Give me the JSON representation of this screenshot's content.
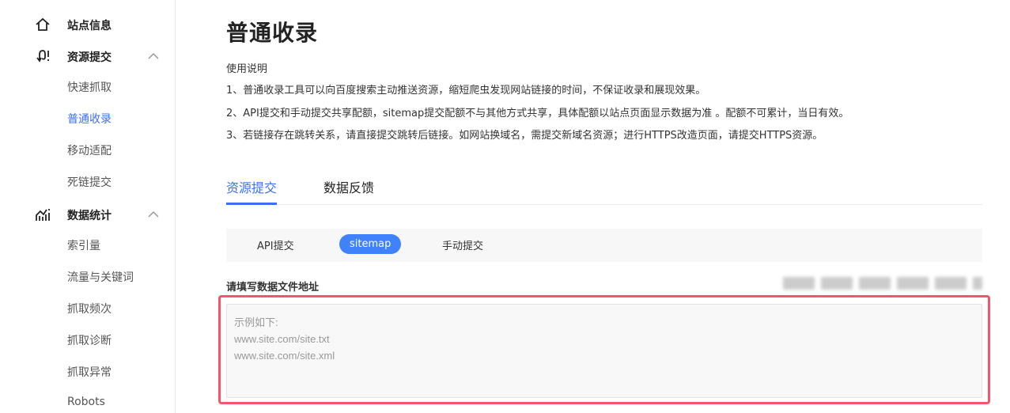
{
  "sidebar": {
    "groups": [
      {
        "label": "站点信息",
        "icon": "home-icon"
      },
      {
        "label": "资源提交",
        "icon": "submit-icon"
      },
      {
        "label": "数据统计",
        "icon": "chart-icon"
      }
    ],
    "resource_items": [
      "快速抓取",
      "普通收录",
      "移动适配",
      "死链提交"
    ],
    "stats_items": [
      "索引量",
      "流量与关键词",
      "抓取频次",
      "抓取诊断",
      "抓取异常",
      "Robots"
    ],
    "active": "普通收录"
  },
  "main": {
    "title": "普通收录",
    "instructions_title": "使用说明",
    "instructions": [
      "1、普通收录工具可以向百度搜索主动推送资源，缩短爬虫发现网站链接的时间，不保证收录和展现效果。",
      "2、API提交和手动提交共享配额，sitemap提交配额不与其他方式共享，具体配额以站点页面显示数据为准 。配额不可累计，当日有效。",
      "3、若链接存在跳转关系，请直接提交跳转后链接。如网站换域名，需提交新域名资源；进行HTTPS改造页面，请提交HTTPS资源。"
    ],
    "tabs": [
      "资源提交",
      "数据反馈"
    ],
    "methods": [
      "API提交",
      "sitemap",
      "手动提交"
    ],
    "field_label": "请填写数据文件地址",
    "placeholder": "示例如下:\nwww.site.com/site.txt\nwww.site.com/site.xml"
  },
  "colors": {
    "accent": "#3b6ff5",
    "highlight": "#f2566a"
  }
}
